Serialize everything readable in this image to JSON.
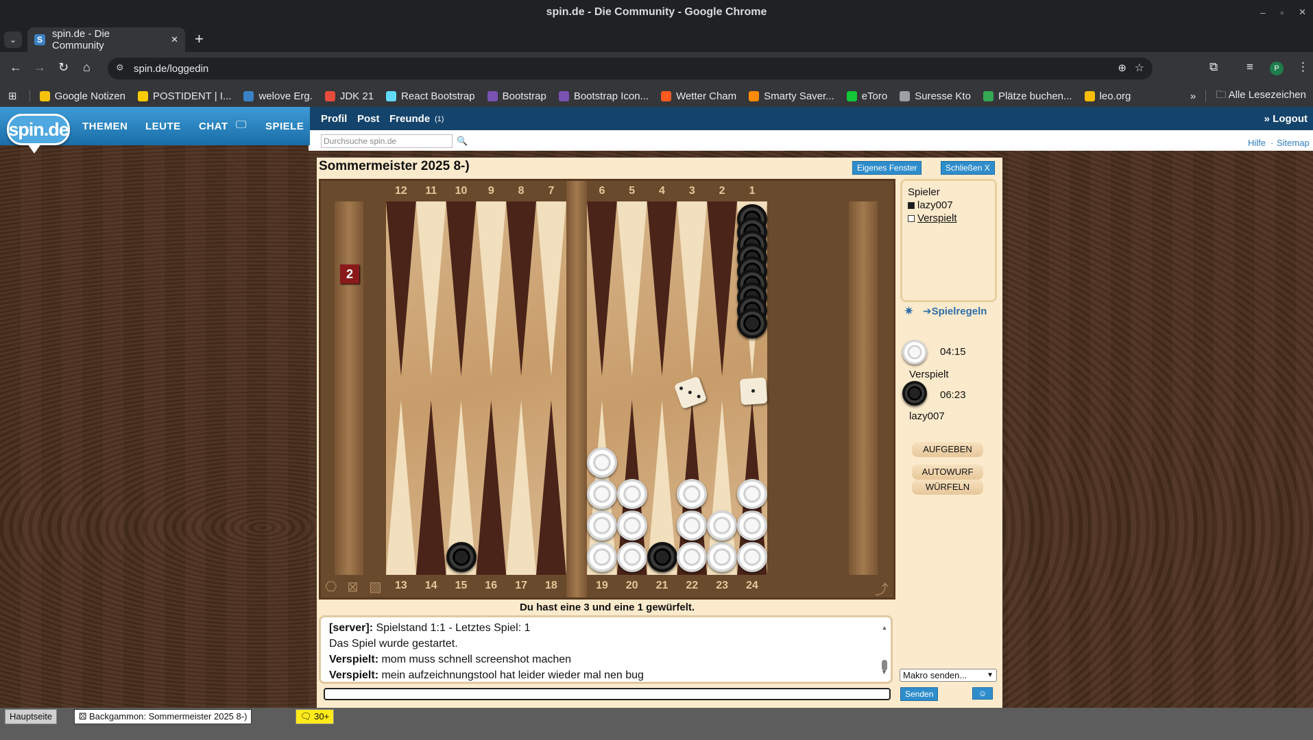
{
  "window": {
    "title": "spin.de - Die Community - Google Chrome"
  },
  "tab": {
    "label": "spin.de - Die Community"
  },
  "address": {
    "url": "spin.de/loggedin"
  },
  "bookmarks": [
    {
      "label": "Google Notizen",
      "color": "#f4c20d"
    },
    {
      "label": "POSTIDENT | I...",
      "color": "#ffcc00"
    },
    {
      "label": "welove Erg.",
      "color": "#3b82c4"
    },
    {
      "label": "JDK 21",
      "color": "#e74c3c"
    },
    {
      "label": "React Bootstrap",
      "color": "#61dafb"
    },
    {
      "label": "Bootstrap",
      "color": "#7952b3"
    },
    {
      "label": "Bootstrap Icon...",
      "color": "#7952b3"
    },
    {
      "label": "Wetter Cham",
      "color": "#ff5a1f"
    },
    {
      "label": "Smarty Saver...",
      "color": "#ff8a00"
    },
    {
      "label": "eToro",
      "color": "#13c636"
    },
    {
      "label": "Suresse Kto",
      "color": "#9aa0a6"
    },
    {
      "label": "Plätze buchen...",
      "color": "#34a853"
    },
    {
      "label": "leo.org",
      "color": "#fbbc04"
    }
  ],
  "bookmarks_more": "»",
  "bookmarks_all": "Alle Lesezeichen",
  "site": {
    "logo": "spin.de",
    "nav": {
      "themen": "THEMEN",
      "leute": "LEUTE",
      "chat": "CHAT",
      "spiele": "SPIELE"
    },
    "sub": {
      "profil": "Profil",
      "post": "Post",
      "freunde": "Freunde",
      "freunde_count": "(1)",
      "logout": "» Logout"
    },
    "search_placeholder": "Durchsuche spin.de",
    "help": "Hilfe",
    "sep": "·",
    "sitemap": "Sitemap"
  },
  "game": {
    "title": "Sommermeister 2025 8-)",
    "own_window": "Eigenes Fenster",
    "close": "Schließen X",
    "doubling_cube": "2",
    "top_numbers": [
      "12",
      "11",
      "10",
      "9",
      "8",
      "7",
      "6",
      "5",
      "4",
      "3",
      "2",
      "1"
    ],
    "bottom_numbers": [
      "13",
      "14",
      "15",
      "16",
      "17",
      "18",
      "19",
      "20",
      "21",
      "22",
      "23",
      "24"
    ],
    "dice": [
      3,
      1
    ],
    "status": "Du hast eine 3 und eine 1 gewürfelt."
  },
  "chat": {
    "lines": [
      {
        "name": "[server]:",
        "text": " Spielstand 1:1 - Letztes Spiel: 1"
      },
      {
        "name": "",
        "text": "Das Spiel wurde gestartet."
      },
      {
        "name": "Verspielt:",
        "text": " mom muss schnell screenshot machen"
      },
      {
        "name": "Verspielt:",
        "text": " mein aufzeichnungstool hat leider wieder mal nen bug"
      }
    ],
    "macro": "Makro senden...",
    "send": "Senden"
  },
  "players": {
    "heading": "Spieler",
    "list": [
      "lazy007",
      "Verspielt"
    ],
    "rules": "Spielregeln",
    "white": {
      "time": "04:15",
      "name": "Verspielt"
    },
    "black": {
      "time": "06:23",
      "name": "lazy007"
    }
  },
  "buttons": {
    "aufgeben": "AUFGEBEN",
    "autowurf": "AUTOWURF",
    "wuerfeln": "WÜRFELN"
  },
  "taskbar": {
    "home": "Hauptseite",
    "game": "Backgammon: Sommermeister 2025 8-)",
    "count": "30+"
  }
}
